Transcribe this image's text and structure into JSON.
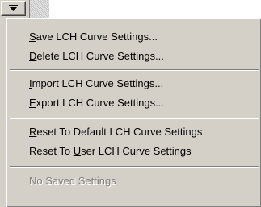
{
  "menu": {
    "items": [
      {
        "pre": "",
        "mnemonic": "S",
        "post": "ave LCH Curve Settings..."
      },
      {
        "pre": "",
        "mnemonic": "D",
        "post": "elete LCH Curve Settings..."
      },
      {
        "pre": "",
        "mnemonic": "I",
        "post": "mport LCH Curve Settings..."
      },
      {
        "pre": "",
        "mnemonic": "E",
        "post": "xport LCH Curve Settings..."
      },
      {
        "pre": "",
        "mnemonic": "R",
        "post": "eset To Default LCH Curve Settings"
      },
      {
        "pre": "Reset To ",
        "mnemonic": "U",
        "post": "ser LCH Curve Settings"
      }
    ],
    "disabled_item": "No Saved Settings"
  },
  "icons": {
    "dropdown": "chevron-down-icon"
  }
}
